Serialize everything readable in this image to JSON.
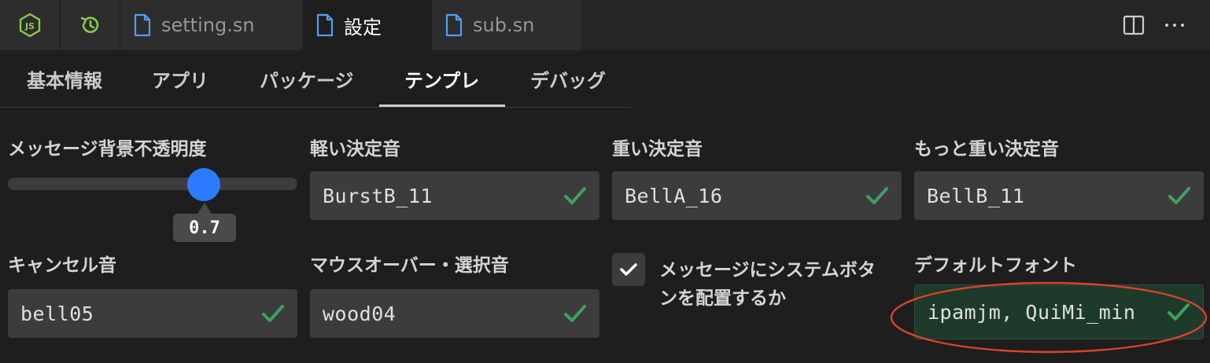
{
  "tabs": [
    {
      "icon": "nodejs-icon"
    },
    {
      "icon": "history-icon"
    },
    {
      "icon": "file-icon",
      "label": "setting.sn",
      "active": false
    },
    {
      "icon": "file-icon",
      "label": "設定",
      "active": true
    },
    {
      "icon": "file-icon",
      "label": "sub.sn",
      "active": false
    }
  ],
  "editor_actions": {
    "split_icon": "split-editor-icon",
    "more_icon": "more-actions-icon"
  },
  "settings_nav": {
    "items": [
      "基本情報",
      "アプリ",
      "パッケージ",
      "テンプレ",
      "デバッグ"
    ],
    "active": "テンプレ"
  },
  "fields": {
    "opacity": {
      "label": "メッセージ背景不透明度",
      "value": "0.7",
      "level": 0.7
    },
    "light_sound": {
      "label": "軽い決定音",
      "value": "BurstB_11"
    },
    "heavy_sound": {
      "label": "重い決定音",
      "value": "BellA_16"
    },
    "heavier_sound": {
      "label": "もっと重い決定音",
      "value": "BellB_11"
    },
    "cancel_sound": {
      "label": "キャンセル音",
      "value": "bell05"
    },
    "hover_sound": {
      "label": "マウスオーバー・選択音",
      "value": "wood04"
    },
    "system_buttons": {
      "label_line1": "メッセージにシステムボタ",
      "label_line2": "ンを配置するか",
      "checked": true
    },
    "default_font": {
      "label": "デフォルトフォント",
      "value": "ipamjm, QuiMi_min"
    }
  },
  "colors": {
    "accent_blue": "#2b7bff",
    "valid_check": "#3fa060",
    "annotation_red": "#d9432f",
    "file_icon": "#4f9ff2",
    "node_green": "#8cc84b"
  }
}
